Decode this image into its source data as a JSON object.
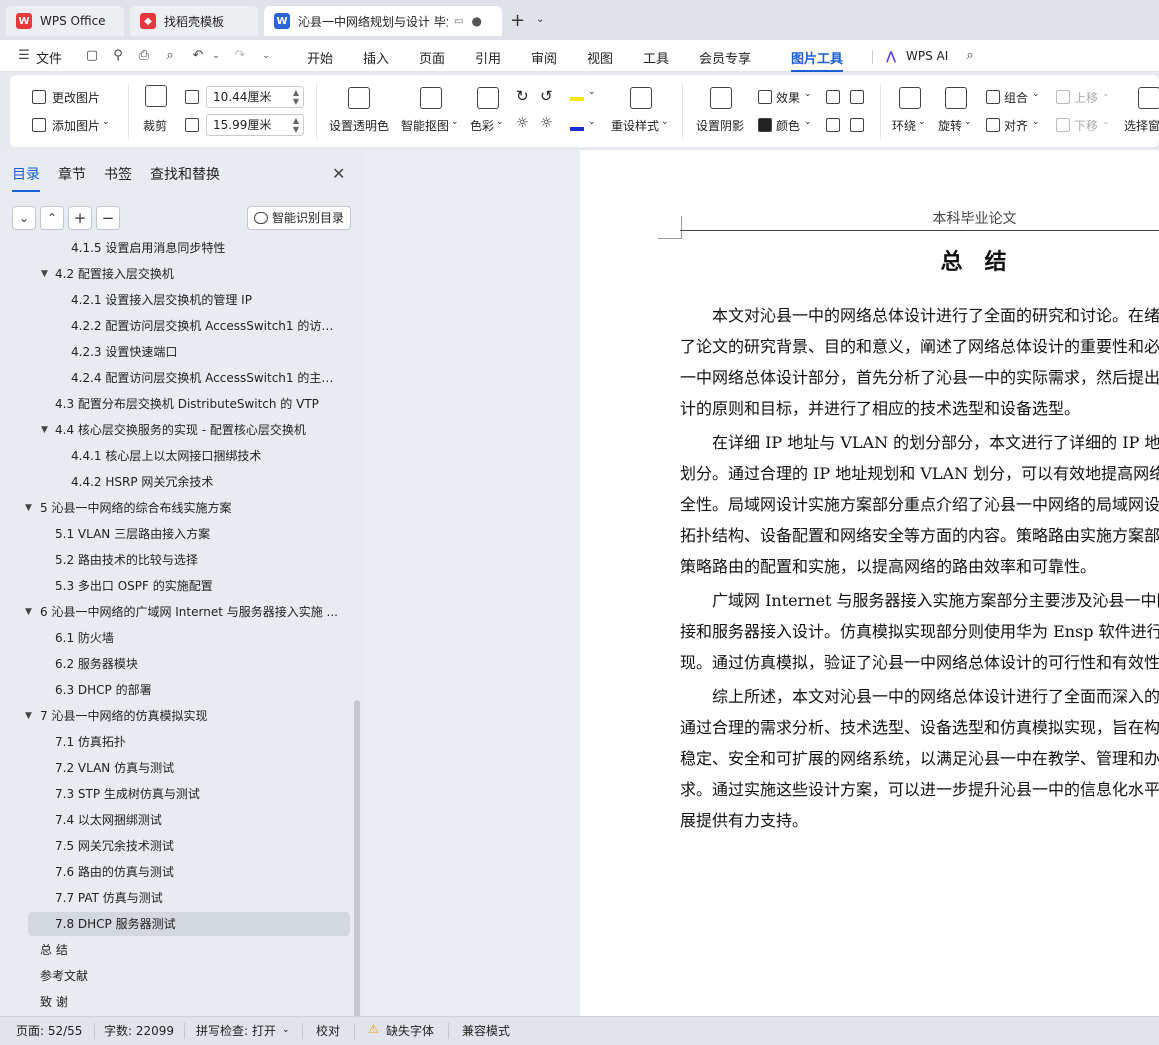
{
  "titlebar": {
    "tabs": [
      {
        "label": "WPS Office",
        "icon": "wps-logo-icon",
        "color": "#e8383d"
      },
      {
        "label": "找稻壳模板",
        "icon": "docer-logo-icon",
        "color": "#e8383d"
      },
      {
        "label": "沁县一中网络规划与设计 毕业",
        "icon": "wps-writer-icon",
        "color": "#2b65d9"
      }
    ],
    "new_tab": "+",
    "new_tab_dropdown": "⌄"
  },
  "menubar": {
    "file": "文件",
    "items": [
      "开始",
      "插入",
      "页面",
      "引用",
      "审阅",
      "视图",
      "工具",
      "会员专享",
      "图片工具"
    ],
    "active": "图片工具",
    "ai": "WPS AI"
  },
  "ribbon": {
    "change_image": "更改图片",
    "add_image": "添加图片",
    "crop": "裁剪",
    "width_value": "10.44厘米",
    "height_value": "15.99厘米",
    "set_transparent": "设置透明色",
    "smart_cutout": "智能抠图",
    "color": "色彩",
    "reset_style": "重设样式",
    "set_shadow": "设置阴影",
    "effect": "效果",
    "color2": "颜色",
    "wrap": "环绕",
    "rotate": "旋转",
    "group": "组合",
    "align": "对齐",
    "move_up": "上移",
    "move_down": "下移",
    "select_pane": "选择窗"
  },
  "leftpanel": {
    "tabs": [
      "目录",
      "章节",
      "书签",
      "查找和替换"
    ],
    "active_tab": "目录",
    "smart_toc": "智能识别目录",
    "toc": [
      {
        "label": "4.1.5 设置启用消息同步特性",
        "level": 3,
        "arrow": ""
      },
      {
        "label": "4.2 配置接入层交换机",
        "level": 2,
        "arrow": "▼"
      },
      {
        "label": "4.2.1 设置接入层交换机的管理 IP",
        "level": 3,
        "arrow": ""
      },
      {
        "label": "4.2.2 配置访问层交换机 AccessSwitch1 的访问 ...",
        "level": 3,
        "arrow": ""
      },
      {
        "label": "4.2.3 设置快速端口",
        "level": 3,
        "arrow": ""
      },
      {
        "label": "4.2.4 配置访问层交换机 AccessSwitch1 的主干 ...",
        "level": 3,
        "arrow": ""
      },
      {
        "label": "4.3  配置分布层交换机 DistributeSwitch 的 VTP",
        "level": 2,
        "arrow": ""
      },
      {
        "label": "4.4  核心层交换服务的实现 - 配置核心层交换机",
        "level": 2,
        "arrow": "▼"
      },
      {
        "label": "4.4.1 核心层上以太网接口捆绑技术",
        "level": 3,
        "arrow": ""
      },
      {
        "label": "4.4.2 HSRP 网关冗余技术",
        "level": 3,
        "arrow": ""
      },
      {
        "label": "5  沁县一中网络的综合布线实施方案",
        "level": 1,
        "arrow": "▼"
      },
      {
        "label": "5.1 VLAN 三层路由接入方案",
        "level": 2,
        "arrow": ""
      },
      {
        "label": "5.2 路由技术的比较与选择",
        "level": 2,
        "arrow": ""
      },
      {
        "label": "5.3 多出口 OSPF 的实施配置",
        "level": 2,
        "arrow": ""
      },
      {
        "label": "6  沁县一中网络的广域网 Internet 与服务器接入实施 ...",
        "level": 1,
        "arrow": "▼"
      },
      {
        "label": "6.1 防火墙",
        "level": 2,
        "arrow": ""
      },
      {
        "label": "6.2 服务器模块",
        "level": 2,
        "arrow": ""
      },
      {
        "label": "6.3 DHCP 的部署",
        "level": 2,
        "arrow": ""
      },
      {
        "label": "7  沁县一中网络的仿真模拟实现",
        "level": 1,
        "arrow": "▼"
      },
      {
        "label": "7.1 仿真拓扑",
        "level": 2,
        "arrow": ""
      },
      {
        "label": "7.2 VLAN 仿真与测试",
        "level": 2,
        "arrow": ""
      },
      {
        "label": "7.3 STP 生成树仿真与测试",
        "level": 2,
        "arrow": ""
      },
      {
        "label": "7.4  以太网捆绑测试",
        "level": 2,
        "arrow": ""
      },
      {
        "label": "7.5 网关冗余技术测试",
        "level": 2,
        "arrow": ""
      },
      {
        "label": "7.6 路由的仿真与测试",
        "level": 2,
        "arrow": ""
      },
      {
        "label": "7.7 PAT 仿真与测试",
        "level": 2,
        "arrow": ""
      },
      {
        "label": "7.8 DHCP 服务器测试",
        "level": 2,
        "arrow": "",
        "selected": true
      },
      {
        "label": "总  结",
        "level": 1,
        "arrow": ""
      },
      {
        "label": "参考文献",
        "level": 1,
        "arrow": ""
      },
      {
        "label": "致  谢",
        "level": 1,
        "arrow": ""
      }
    ]
  },
  "document": {
    "running_header": "本科毕业论文",
    "title": "总结",
    "paragraphs": [
      [
        "本文对沁县一中的网络总体设计进行了全面的研究和讨论。在绪",
        "了论文的研究背景、目的和意义，阐述了网络总体设计的重要性和必",
        "一中网络总体设计部分，首先分析了沁县一中的实际需求，然后提出",
        "计的原则和目标，并进行了相应的技术选型和设备选型。"
      ],
      [
        "在详细 IP 地址与 VLAN 的划分部分，本文进行了详细的 IP 地址",
        "划分。通过合理的 IP 地址规划和 VLAN 划分，可以有效地提高网络",
        "全性。局域网设计实施方案部分重点介绍了沁县一中网络的局域网设",
        "拓扑结构、设备配置和网络安全等方面的内容。策略路由实施方案部",
        "策略路由的配置和实施，以提高网络的路由效率和可靠性。"
      ],
      [
        "广域网 Internet 与服务器接入实施方案部分主要涉及沁县一中网",
        "接和服务器接入设计。仿真模拟实现部分则使用华为 Ensp 软件进行",
        "现。通过仿真模拟，验证了沁县一中网络总体设计的可行性和有效性"
      ],
      [
        "综上所述，本文对沁县一中的网络总体设计进行了全面而深入的",
        "通过合理的需求分析、技术选型、设备选型和仿真模拟实现，旨在构",
        "稳定、安全和可扩展的网络系统，以满足沁县一中在教学、管理和办",
        "求。通过实施这些设计方案，可以进一步提升沁县一中的信息化水平",
        "展提供有力支持。"
      ]
    ]
  },
  "statusbar": {
    "page": "页面: 52/55",
    "word_count": "字数: 22099",
    "spellcheck": "拼写检查: 打开",
    "proofread": "校对",
    "missing_font": "缺失字体",
    "compat_mode": "兼容模式"
  },
  "colors": {
    "accent": "#1a5fd6",
    "wps_red": "#e8383d",
    "writer_blue": "#2b65d9",
    "warning": "#e8a317"
  }
}
